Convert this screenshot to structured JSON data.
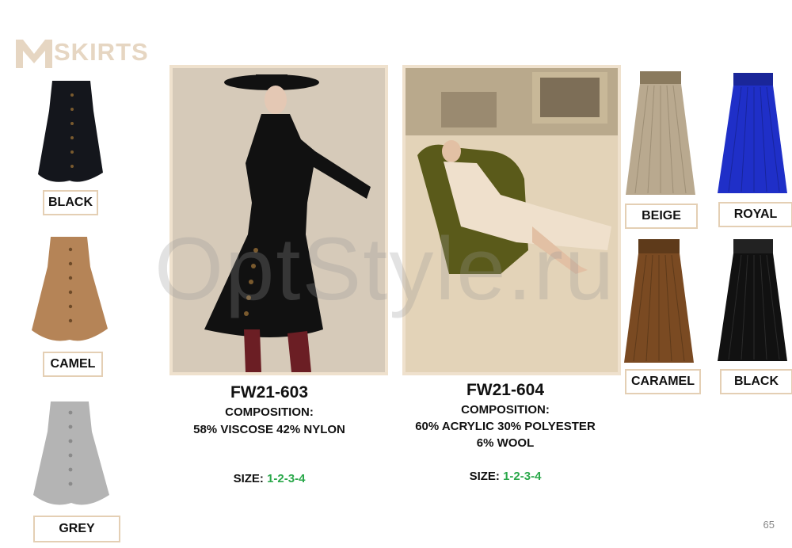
{
  "brand": {
    "logo_letter": "M",
    "section": "SKIRTS"
  },
  "left_swatches": [
    {
      "label": "BLACK",
      "color": "#14161c"
    },
    {
      "label": "CAMEL",
      "color": "#b58457"
    },
    {
      "label": "GREY",
      "color": "#b4b4b4"
    }
  ],
  "model_603": {
    "code": "FW21-603",
    "composition_label": "COMPOSITION:",
    "composition": "58% VISCOSE 42% NYLON",
    "size_label": "SIZE:",
    "size_value": "1-2-3-4"
  },
  "model_604": {
    "code": "FW21-604",
    "composition_label": "COMPOSITION:",
    "composition_line1": "60% ACRYLIC 30% POLYESTER",
    "composition_line2": "6% WOOL",
    "size_label": "SIZE:",
    "size_value": "1-2-3-4"
  },
  "right_swatches": [
    {
      "label": "BEIGE",
      "color": "#b9a98f"
    },
    {
      "label": "ROYAL",
      "color": "#1f2fc8"
    },
    {
      "label": "CARAMEL",
      "color": "#7a4a22"
    },
    {
      "label": "BLACK",
      "color": "#111111"
    }
  ],
  "watermark": "OptStyle.ru",
  "page_number": "65"
}
